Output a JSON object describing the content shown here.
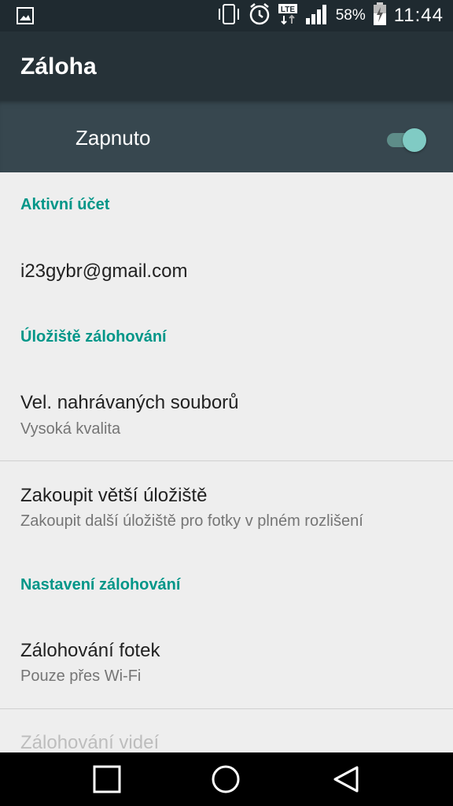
{
  "status_bar": {
    "battery_percent": "58%",
    "time": "11:44",
    "network_type": "LTE",
    "icons": [
      "image-icon",
      "vibrate-icon",
      "alarm-icon",
      "lte-icon",
      "signal-icon",
      "battery-charging-icon"
    ]
  },
  "app_bar": {
    "title": "Záloha"
  },
  "master_switch": {
    "label": "Zapnuto",
    "state": true
  },
  "sections": {
    "account_header": "Aktivní účet",
    "account_email": "i23gybr@gmail.com",
    "storage_header": "Úložiště zálohování",
    "upload_size_title": "Vel. nahrávaných souborů",
    "upload_size_value": "Vysoká kvalita",
    "buy_storage_title": "Zakoupit větší úložiště",
    "buy_storage_sub": "Zakoupit další úložiště pro fotky v plném rozlišení",
    "settings_header": "Nastavení zálohování",
    "photo_backup_title": "Zálohování fotek",
    "photo_backup_value": "Pouze přes Wi-Fi",
    "video_backup_title": "Zálohování videí"
  },
  "nav_bar": {
    "icons": [
      "recents-icon",
      "home-icon",
      "back-icon"
    ]
  },
  "colors": {
    "accent": "#009688",
    "app_bar": "#263238",
    "switch_thumb": "#80cbc4"
  }
}
